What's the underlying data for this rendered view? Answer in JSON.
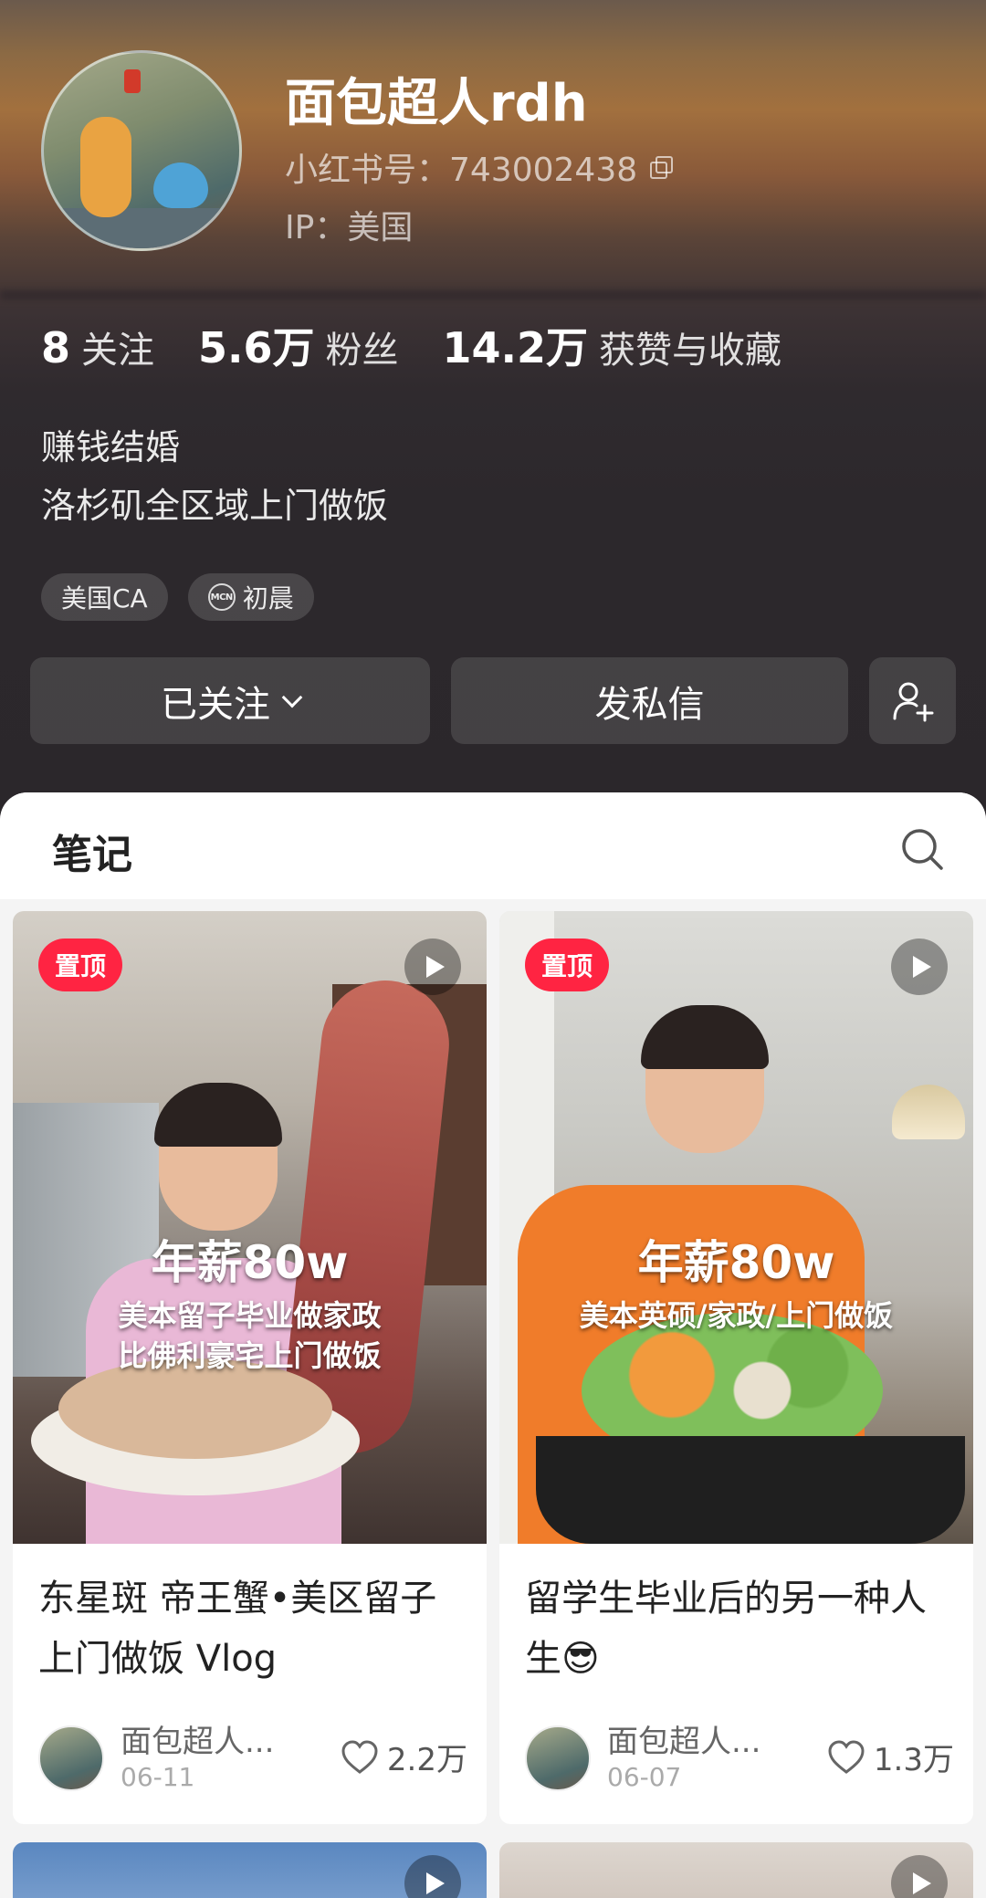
{
  "profile": {
    "username": "面包超人rdh",
    "red_id": "小红书号：743002438",
    "ip": "IP：美国",
    "stats": [
      {
        "num": "8",
        "label": "关注"
      },
      {
        "num": "5.6万",
        "label": "粉丝"
      },
      {
        "num": "14.2万",
        "label": "获赞与收藏"
      }
    ],
    "bio_lines": [
      "赚钱结婚",
      "洛杉矶全区域上门做饭"
    ],
    "tags": {
      "location": "美国CA",
      "mcn": "初晨",
      "mcn_icon_text": "MCN"
    },
    "buttons": {
      "follow": "已关注",
      "message": "发私信"
    }
  },
  "tabs": {
    "notes": "笔记"
  },
  "notes": [
    {
      "pin": "置顶",
      "overlay_big": "年薪80w",
      "overlay_line1": "美本留子毕业做家政",
      "overlay_line2": "比佛利豪宅上门做饭",
      "title": "东星斑 帝王蟹•美区留子上门做饭 Vlog",
      "author": "面包超人...",
      "date": "06-11",
      "likes": "2.2万"
    },
    {
      "pin": "置顶",
      "overlay_big": "年薪80w",
      "overlay_line1": "美本英硕/家政/上门做饭",
      "title": "留学生毕业后的另一种人生😎",
      "author": "面包超人...",
      "date": "06-07",
      "likes": "1.3万"
    }
  ],
  "colors": {
    "accent": "#ff2442",
    "header_bg": "#2b272b"
  },
  "icons": [
    "copy-icon",
    "chevron-down-icon",
    "add-user-icon",
    "search-icon",
    "play-icon",
    "heart-icon",
    "mcn-icon"
  ]
}
